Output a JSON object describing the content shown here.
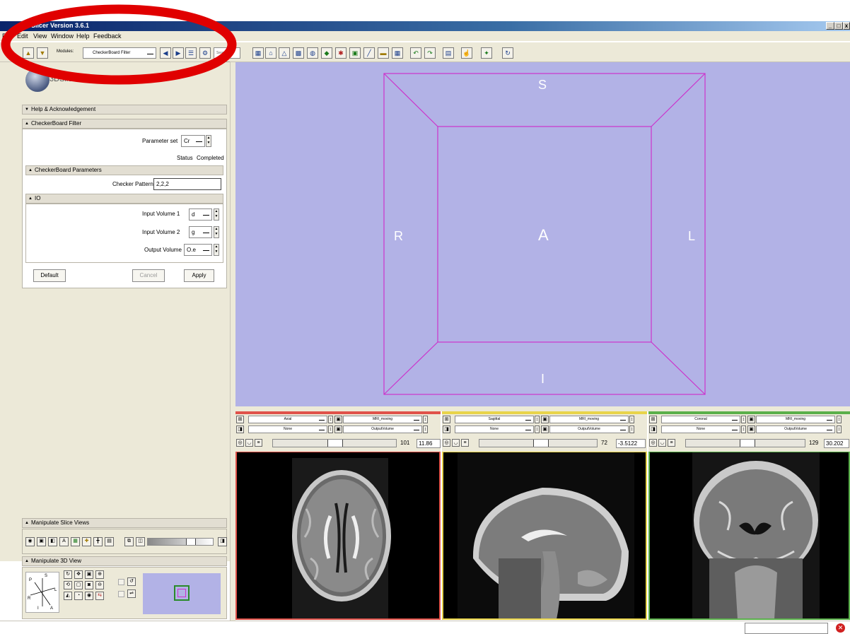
{
  "window": {
    "title": "Slicer Version 3.6.1",
    "controls": [
      "_",
      "□",
      "x"
    ]
  },
  "menu": [
    "File",
    "Edit",
    "View",
    "Window",
    "Help",
    "Feedback"
  ],
  "toolbar": {
    "modules_label": "Modules:",
    "module_selected": "CheckerBoard Filter",
    "search_placeholder": "Search Modules"
  },
  "logo_text": "3DSlicer",
  "sections": {
    "help": "Help & Acknowledgement",
    "checkerboard": "CheckerBoard Filter",
    "parameters": "CheckerBoard Parameters",
    "io": "IO",
    "manip_slice": "Manipulate Slice Views",
    "manip_3d": "Manipulate 3D View"
  },
  "form": {
    "parameter_set_label": "Parameter set",
    "parameter_set_value": "Cr",
    "status_label": "Status",
    "status_value": "Completed",
    "checker_pattern_label": "Checker Pattern",
    "checker_pattern_value": "2,2,2",
    "input1_label": "Input Volume 1",
    "input1_value": "d",
    "input2_label": "Input Volume 2",
    "input2_value": "g",
    "output_label": "Output Volume",
    "output_value": "O.e"
  },
  "buttons": {
    "default": "Default",
    "cancel": "Cancel",
    "apply": "Apply"
  },
  "view3d": {
    "labels": {
      "S": "S",
      "I": "I",
      "R": "R",
      "L": "L",
      "A": "A"
    },
    "bg_color": "#b2b2e6",
    "box_color": "#cc33cc"
  },
  "orientation_labels": {
    "P": "P",
    "S": "S",
    "R": "R",
    "L": "L",
    "I": "I",
    "A": "A"
  },
  "slices": [
    {
      "color": "#e0524a",
      "orientation": "Axial",
      "label_select": "None",
      "fg": "MRI_moving",
      "bg": "OutputVolume",
      "index": "101",
      "offset": "11.86",
      "slider_fraction": 0.5
    },
    {
      "color": "#e8d44a",
      "orientation": "Sagittal",
      "label_select": "None",
      "fg": "MRI_moving",
      "bg": "OutputVolume",
      "index": "72",
      "offset": "-3.5122",
      "slider_fraction": 0.52
    },
    {
      "color": "#5ab04a",
      "orientation": "Coronal",
      "label_select": "None",
      "fg": "MRI_moving",
      "bg": "OutputVolume",
      "index": "129",
      "offset": "30.202",
      "slider_fraction": 0.5
    }
  ],
  "annotation": {
    "color": "#e00000"
  }
}
